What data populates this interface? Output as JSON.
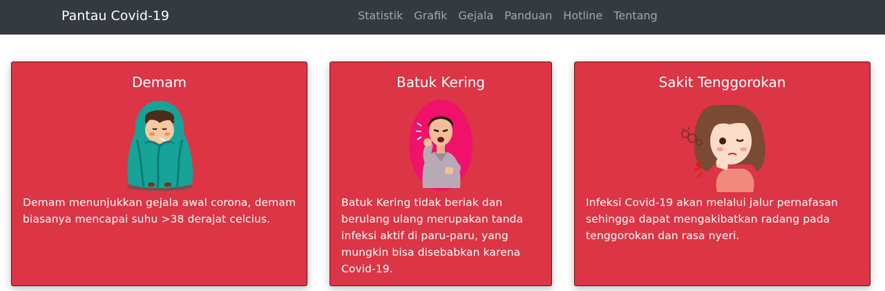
{
  "navbar": {
    "brand": "Pantau Covid-19",
    "links": [
      "Statistik",
      "Grafik",
      "Gejala",
      "Panduan",
      "Hotline",
      "Tentang"
    ]
  },
  "cards": [
    {
      "title": "Demam",
      "illustration": "sick-child-blanket-icon",
      "text": "Demam menunjukkan gejala awal corona, demam biasanya mencapai suhu >38 derajat celcius."
    },
    {
      "title": "Batuk Kering",
      "illustration": "coughing-man-icon",
      "text": "Batuk Kering tidak beriak dan berulang ulang merupakan tanda infeksi aktif di paru-paru, yang mungkin bisa disebabkan karena Covid-19."
    },
    {
      "title": "Sakit Tenggorokan",
      "illustration": "sore-throat-girl-icon",
      "text": "Infeksi Covid-19 akan melalui jalur pernafasan sehingga dapat mengakibatkan radang pada tenggorokan dan rasa nyeri."
    }
  ],
  "colors": {
    "navbar": "#343a40",
    "card": "#dc3545",
    "text": "#ffffff"
  }
}
